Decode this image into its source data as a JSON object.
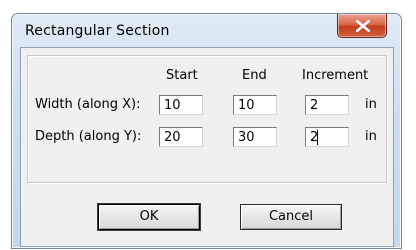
{
  "dialog": {
    "title": "Rectangular Section",
    "close_icon": "close-icon"
  },
  "columns": {
    "start": "Start",
    "end": "End",
    "increment": "Increment"
  },
  "rows": [
    {
      "label": "Width (along X):",
      "start": "10",
      "end": "10",
      "increment": "2",
      "unit": "in"
    },
    {
      "label": "Depth (along Y):",
      "start": "20",
      "end": "30",
      "increment": "2",
      "unit": "in"
    }
  ],
  "buttons": {
    "ok": "OK",
    "cancel": "Cancel"
  },
  "colors": {
    "close_button": "#c43c1e",
    "frame": "#c4d7ec"
  }
}
